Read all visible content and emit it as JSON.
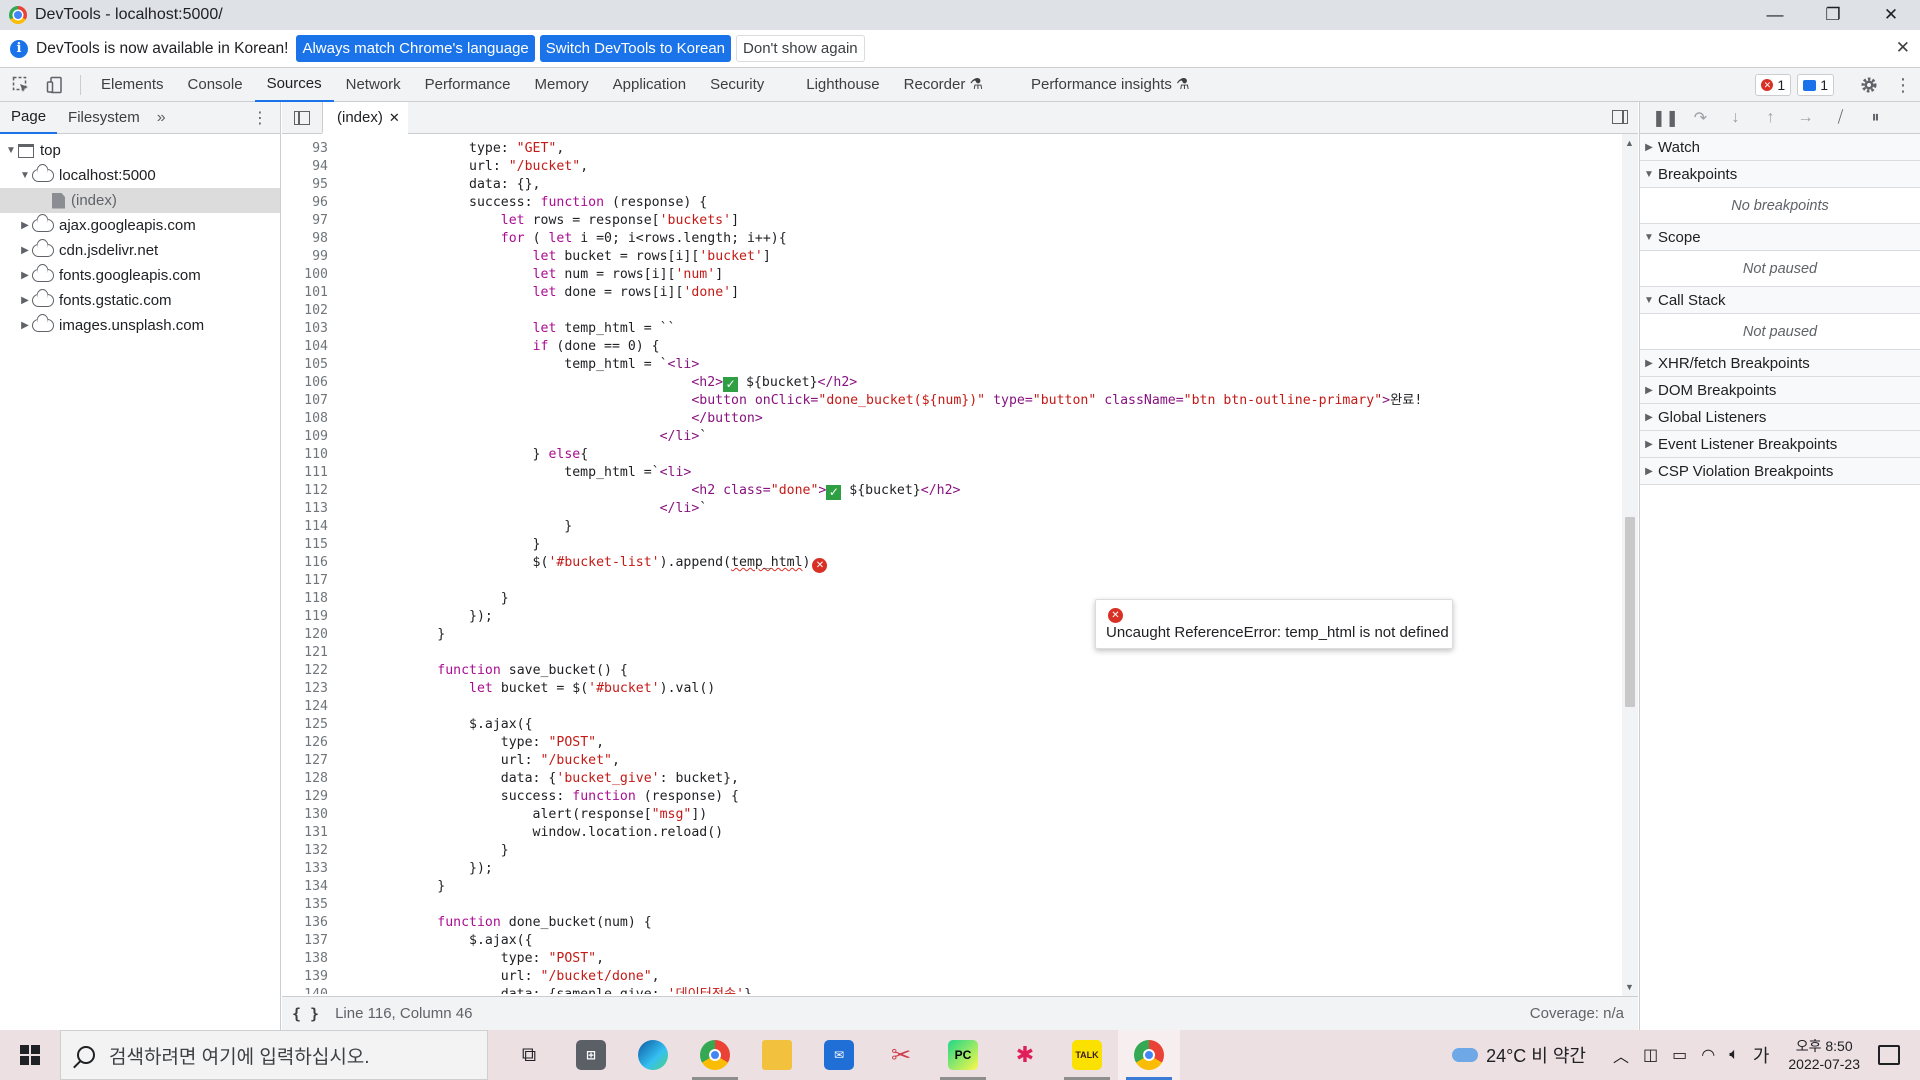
{
  "window": {
    "title": "DevTools - localhost:5000/"
  },
  "window_controls": {
    "minimize": "—",
    "restore": "❐",
    "close": "✕"
  },
  "infobar": {
    "message": "DevTools is now available in Korean!",
    "btn_match": "Always match Chrome's language",
    "btn_switch": "Switch DevTools to Korean",
    "btn_dismiss": "Don't show again"
  },
  "tabs": [
    "Elements",
    "Console",
    "Sources",
    "Network",
    "Performance",
    "Memory",
    "Application",
    "Security",
    "Lighthouse",
    "Recorder ⚗",
    "Performance insights ⚗"
  ],
  "badges": {
    "errors": "1",
    "messages": "1"
  },
  "navigator": {
    "tabs": [
      "Page",
      "Filesystem"
    ],
    "more": "»",
    "tree": {
      "top": "top",
      "host": "localhost:5000",
      "index": "(index)",
      "domains": [
        "ajax.googleapis.com",
        "cdn.jsdelivr.net",
        "fonts.googleapis.com",
        "fonts.gstatic.com",
        "images.unsplash.com"
      ]
    }
  },
  "editor": {
    "file_tab": "(index)",
    "error_tooltip": "Uncaught ReferenceError: temp_html is not defined",
    "status_position": "Line 116, Column 46",
    "status_braces": "{ }",
    "coverage": "Coverage: n/a"
  },
  "code_lines": [
    {
      "n": "93",
      "t": "                type: \"GET\","
    },
    {
      "n": "94",
      "t": "                url: \"/bucket\","
    },
    {
      "n": "95",
      "t": "                data: {},"
    },
    {
      "n": "96",
      "t": "                success: function (response) {"
    },
    {
      "n": "97",
      "t": "                    let rows = response['buckets']"
    },
    {
      "n": "98",
      "t": "                    for ( let i =0; i<rows.length; i++){"
    },
    {
      "n": "99",
      "t": "                        let bucket = rows[i]['bucket']"
    },
    {
      "n": "100",
      "t": "                        let num = rows[i]['num']"
    },
    {
      "n": "101",
      "t": "                        let done = rows[i]['done']"
    },
    {
      "n": "102",
      "t": ""
    },
    {
      "n": "103",
      "t": "                        let temp_html = ``"
    },
    {
      "n": "104",
      "t": "                        if (done == 0) {"
    },
    {
      "n": "105",
      "t": "                            temp_html = `<li>"
    },
    {
      "n": "106",
      "t": "                                            <h2>✅ ${bucket}</h2>"
    },
    {
      "n": "107",
      "t": "                                            <button onClick=\"done_bucket(${num})\" type=\"button\" className=\"btn btn-outline-primary\">완료!"
    },
    {
      "n": "108",
      "t": "                                            </button>"
    },
    {
      "n": "109",
      "t": "                                        </li>`"
    },
    {
      "n": "110",
      "t": "                        } else{"
    },
    {
      "n": "111",
      "t": "                            temp_html =`<li>"
    },
    {
      "n": "112",
      "t": "                                            <h2 class=\"done\">✅ ${bucket}</h2>"
    },
    {
      "n": "113",
      "t": "                                        </li>`"
    },
    {
      "n": "114",
      "t": "                            }"
    },
    {
      "n": "115",
      "t": "                        }"
    },
    {
      "n": "116",
      "t": "                        $('#bucket-list').append(temp_html)"
    },
    {
      "n": "117",
      "t": ""
    },
    {
      "n": "118",
      "t": "                    }"
    },
    {
      "n": "119",
      "t": "                });"
    },
    {
      "n": "120",
      "t": "            }"
    },
    {
      "n": "121",
      "t": ""
    },
    {
      "n": "122",
      "t": "            function save_bucket() {"
    },
    {
      "n": "123",
      "t": "                let bucket = $('#bucket').val()"
    },
    {
      "n": "124",
      "t": ""
    },
    {
      "n": "125",
      "t": "                $.ajax({"
    },
    {
      "n": "126",
      "t": "                    type: \"POST\","
    },
    {
      "n": "127",
      "t": "                    url: \"/bucket\","
    },
    {
      "n": "128",
      "t": "                    data: {'bucket_give': bucket},"
    },
    {
      "n": "129",
      "t": "                    success: function (response) {"
    },
    {
      "n": "130",
      "t": "                        alert(response[\"msg\"])"
    },
    {
      "n": "131",
      "t": "                        window.location.reload()"
    },
    {
      "n": "132",
      "t": "                    }"
    },
    {
      "n": "133",
      "t": "                });"
    },
    {
      "n": "134",
      "t": "            }"
    },
    {
      "n": "135",
      "t": ""
    },
    {
      "n": "136",
      "t": "            function done_bucket(num) {"
    },
    {
      "n": "137",
      "t": "                $.ajax({"
    },
    {
      "n": "138",
      "t": "                    type: \"POST\","
    },
    {
      "n": "139",
      "t": "                    url: \"/bucket/done\","
    },
    {
      "n": "140",
      "t": "                    data: {samenle_give: '데이터전송'},"
    }
  ],
  "debugger": {
    "sections": {
      "watch": "Watch",
      "breakpoints": "Breakpoints",
      "breakpoints_empty": "No breakpoints",
      "scope": "Scope",
      "scope_empty": "Not paused",
      "callstack": "Call Stack",
      "callstack_empty": "Not paused",
      "xhr": "XHR/fetch Breakpoints",
      "dom": "DOM Breakpoints",
      "global": "Global Listeners",
      "event": "Event Listener Breakpoints",
      "csp": "CSP Violation Breakpoints"
    }
  },
  "taskbar": {
    "search_placeholder": "검색하려면 여기에 입력하십시오.",
    "weather": "24°C  비 약간",
    "ime": "가",
    "time": "오후 8:50",
    "date": "2022-07-23"
  },
  "colors": {
    "accent": "#1a73e8",
    "error": "#d93025",
    "keyword": "#aa0d91",
    "string": "#c41a16"
  }
}
